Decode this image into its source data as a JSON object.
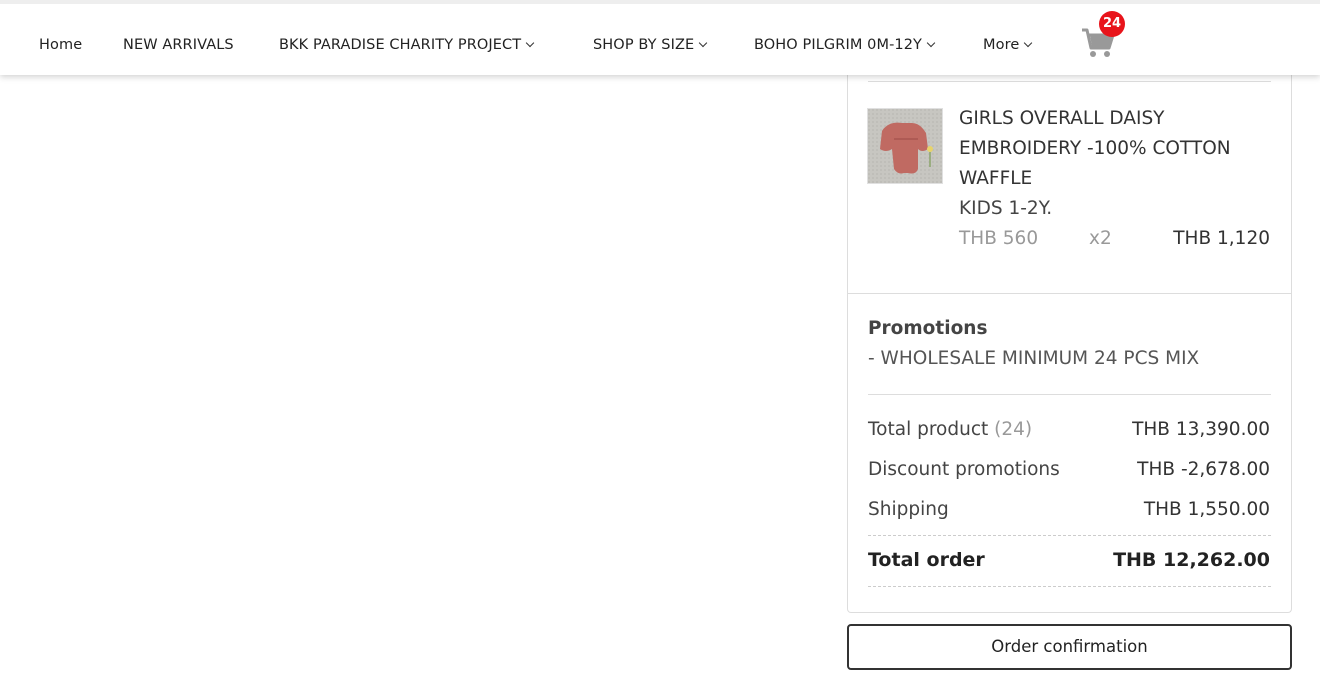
{
  "nav": {
    "items": [
      {
        "label": "Home",
        "has_dropdown": false
      },
      {
        "label": "NEW ARRIVALS",
        "has_dropdown": false
      },
      {
        "label": "BKK PARADISE CHARITY PROJECT",
        "has_dropdown": true
      },
      {
        "label": "SHOP BY SIZE",
        "has_dropdown": true
      },
      {
        "label": "BOHO PILGRIM 0M-12Y",
        "has_dropdown": true
      },
      {
        "label": "More",
        "has_dropdown": true
      }
    ],
    "cart": {
      "icon": "shopping-cart-icon",
      "count": "24",
      "badge_color": "#e8141b",
      "icon_color": "#999999"
    }
  },
  "order_summary": {
    "product": {
      "name": "GIRLS OVERALL DAISY EMBROIDERY -100% COTTON WAFFLE",
      "variant": "KIDS 1-2Y.",
      "unit_price": "THB 560",
      "quantity": "x2",
      "line_total": "THB 1,120"
    },
    "promotions": {
      "title": "Promotions",
      "items": [
        "- WHOLESALE MINIMUM 24 PCS MIX"
      ]
    },
    "totals": {
      "product_label": "Total product",
      "product_count": "(24)",
      "product_value": "THB 13,390.00",
      "discount_label": "Discount promotions",
      "discount_value": "THB -2,678.00",
      "shipping_label": "Shipping",
      "shipping_value": "THB 1,550.00",
      "order_label": "Total order",
      "order_value": "THB 12,262.00"
    },
    "confirm_button": "Order confirmation"
  }
}
